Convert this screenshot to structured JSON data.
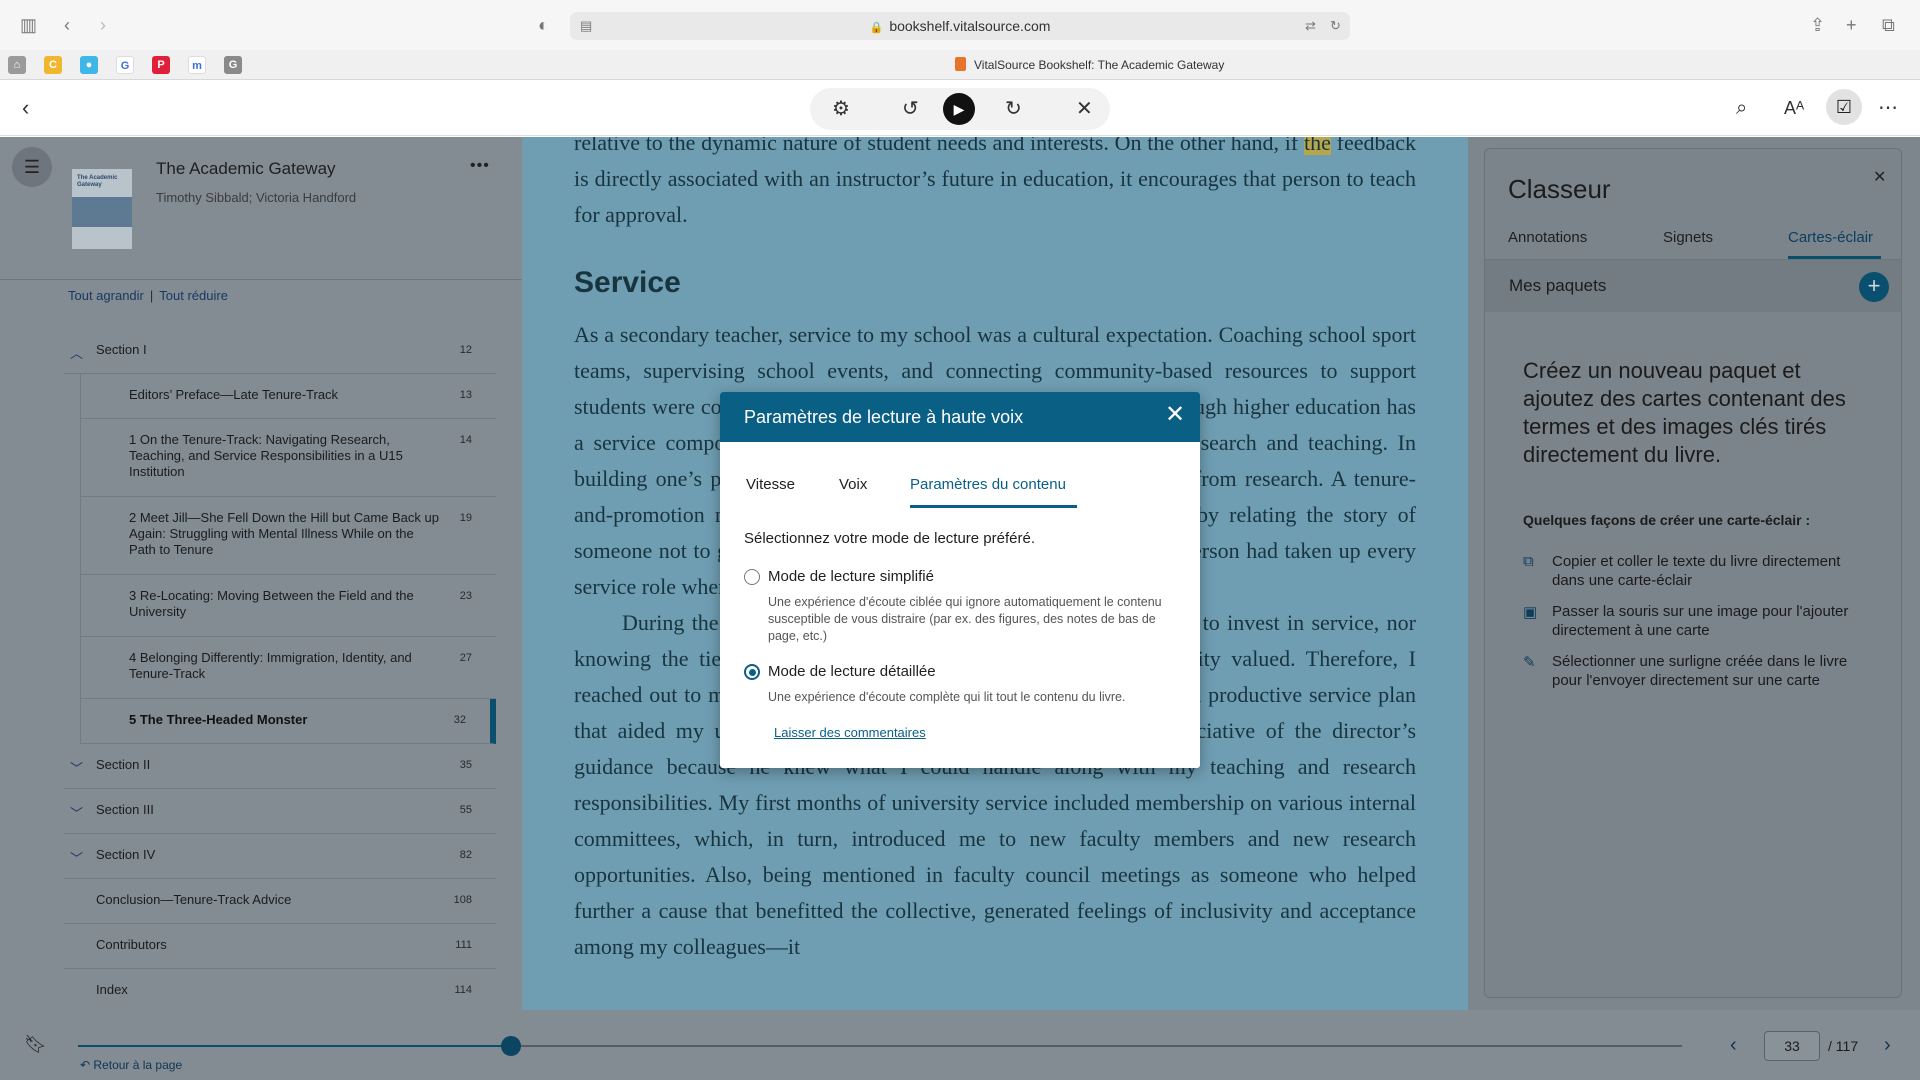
{
  "browser": {
    "url": "bookshelf.vitalsource.com",
    "tab_title": "VitalSource Bookshelf: The Academic Gateway",
    "favorites": [
      {
        "icon": "bank-icon",
        "color": "#9a9a9a",
        "glyph": "⌂"
      },
      {
        "icon": "c-icon",
        "color": "#f0b62e",
        "glyph": "C"
      },
      {
        "icon": "shield-icon",
        "color": "#3fb6e8",
        "glyph": "●"
      },
      {
        "icon": "google-icon",
        "color": "#ffffff",
        "glyph": "G"
      },
      {
        "icon": "pinterest-icon",
        "color": "#e0203b",
        "glyph": "P"
      },
      {
        "icon": "m-icon",
        "color": "#ffffff",
        "glyph": "m"
      },
      {
        "icon": "g-icon",
        "color": "#8a8a8a",
        "glyph": "G"
      }
    ]
  },
  "book": {
    "title": "The Academic Gateway",
    "authors": "Timothy Sibbald; Victoria Handford",
    "cover_title": "The Academic Gateway"
  },
  "toc": {
    "expand_all": "Tout agrandir",
    "collapse_all": "Tout réduire",
    "items": [
      {
        "label": "Section I",
        "page": "12",
        "level": 0,
        "chevron": "up"
      },
      {
        "label": "Editors’ Preface—Late Tenure-Track",
        "page": "13",
        "level": 1
      },
      {
        "label": "1 On the Tenure-Track: Navigating Research, Teaching, and Service Responsibilities in a U15 Institution",
        "page": "14",
        "level": 1
      },
      {
        "label": "2 Meet Jill—She Fell Down the Hill but Came Back up Again: Struggling with Mental Illness While on the Path to Tenure",
        "page": "19",
        "level": 1
      },
      {
        "label": "3 Re-Locating: Moving Between the Field and the University",
        "page": "23",
        "level": 1
      },
      {
        "label": "4 Belonging Differently: Immigration, Identity, and Tenure-Track",
        "page": "27",
        "level": 1
      },
      {
        "label": "5 The Three-Headed Monster",
        "page": "32",
        "level": 1,
        "current": true
      },
      {
        "label": "Section II",
        "page": "35",
        "level": 0,
        "chevron": "down"
      },
      {
        "label": "Section III",
        "page": "55",
        "level": 0,
        "chevron": "down"
      },
      {
        "label": "Section IV",
        "page": "82",
        "level": 0,
        "chevron": "down"
      },
      {
        "label": "Conclusion—Tenure-Track Advice",
        "page": "108",
        "level": 0
      },
      {
        "label": "Contributors",
        "page": "111",
        "level": 0
      },
      {
        "label": "Index",
        "page": "114",
        "level": 0
      }
    ]
  },
  "reader": {
    "para1_before": "relative to the dynamic nature of student needs and interests. On the other hand, if ",
    "para1_highlight": "the",
    "para1_after": " feedback is directly associated with an instructor’s future in education, it encourages that person to teach for approval.",
    "heading": "Service",
    "para2": "As a secondary teacher, service to my school was a cultural expectation. Coaching school sport teams, supervising school events, and connecting community-based resources to support students were considered to be part of my professional practice. Although higher education has a service component, service is perceived as less important than research and teaching. In building one’s profile within the university, recognition comes first from research. A tenure-and-promotion member reaffirmed my commitment to scholarship by relating the story of someone not to gain tenure due to lack of scholarly output, yet that person had taken up every service role when the opportunity arises, but its priority remains low.",
    "para3": "During the first year, I did not have a clear sense of how much to invest in service, nor knowing the tie between service and what the university community valued. Therefore, I reached out to my director, who helped me map out a workload and a productive service plan that aided my understanding of university operations. I was appreciative of the director’s guidance because he knew what I could handle along with my teaching and research responsibilities. My first months of university service included membership on various internal committees, which, in turn, introduced me to new faculty members and new research opportunities. Also, being mentioned in faculty council meetings as someone who helped further a cause that benefitted the collective, generated feelings of inclusivity and acceptance among my colleagues—it"
  },
  "classeur": {
    "title": "Classeur",
    "tabs": [
      "Annotations",
      "Signets",
      "Cartes-éclair"
    ],
    "active_tab": "Cartes-éclair",
    "packs_label": "Mes paquets",
    "intro": "Créez un nouveau paquet et ajoutez des cartes contenant des termes et des images clés tirés directement du livre.",
    "ways_title": "Quelques façons de créer une carte-éclair :",
    "ways": [
      {
        "icon": "copy-icon",
        "glyph": "⧉",
        "text": "Copier et coller le texte du livre directement dans une carte-éclair"
      },
      {
        "icon": "image-icon",
        "glyph": "▣",
        "text": "Passer la souris sur une image pour l'ajouter directement à une carte"
      },
      {
        "icon": "pencil-icon",
        "glyph": "✎",
        "text": "Sélectionner une surligne créée dans le livre pour l'envoyer directement sur une carte"
      }
    ]
  },
  "modal": {
    "title": "Paramètres de lecture à haute voix",
    "tabs": [
      "Vitesse",
      "Voix",
      "Paramètres du contenu"
    ],
    "active_tab": "Paramètres du contenu",
    "prompt": "Sélectionnez votre mode de lecture préféré.",
    "options": [
      {
        "label": "Mode de lecture simplifié",
        "desc": "Une expérience d'écoute ciblée qui ignore automatiquement le contenu susceptible de vous distraire (par ex. des figures, des notes de bas de page, etc.)",
        "checked": false
      },
      {
        "label": "Mode de lecture détaillée",
        "desc": "Une expérience d'écoute complète qui lit tout le contenu du livre.",
        "checked": true
      }
    ],
    "feedback": "Laisser des commentaires"
  },
  "footer": {
    "back_to_page": "Retour à la page",
    "page": "33",
    "total": "/ 117",
    "progress": 0.27
  }
}
